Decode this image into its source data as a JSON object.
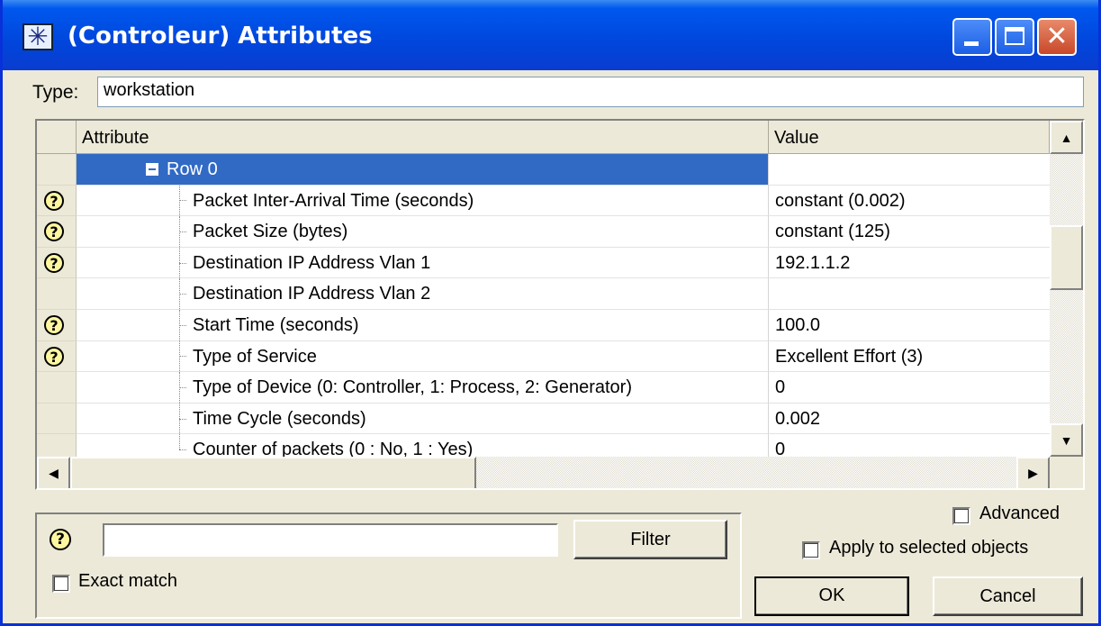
{
  "window": {
    "title": "(Controleur) Attributes",
    "close_glyph": "✕"
  },
  "type_field": {
    "label": "Type:",
    "value": "workstation"
  },
  "grid": {
    "columns": {
      "attribute": "Attribute",
      "value": "Value"
    },
    "group_row": "Row 0",
    "rows": [
      {
        "attribute": "Packet Inter-Arrival Time (seconds)",
        "value": "constant (0.002)",
        "help": true
      },
      {
        "attribute": "Packet Size (bytes)",
        "value": "constant (125)",
        "help": true
      },
      {
        "attribute": "Destination IP Address Vlan 1",
        "value": "192.1.1.2",
        "help": true
      },
      {
        "attribute": "Destination IP Address Vlan 2",
        "value": "",
        "help": false
      },
      {
        "attribute": "Start Time (seconds)",
        "value": "100.0",
        "help": true
      },
      {
        "attribute": "Type of Service",
        "value": "Excellent Effort (3)",
        "help": true
      },
      {
        "attribute": "Type of Device (0: Controller, 1: Process, 2: Generator)",
        "value": "0",
        "help": false
      },
      {
        "attribute": "Time Cycle (seconds)",
        "value": "0.002",
        "help": false
      },
      {
        "attribute": "Counter of packets (0 : No, 1 : Yes)",
        "value": "0",
        "help": false
      }
    ],
    "help_glyph": "?"
  },
  "filter": {
    "input_value": "",
    "button_label": "Filter",
    "exact_match_label": "Exact match",
    "exact_match_checked": false
  },
  "options": {
    "advanced_label": "Advanced",
    "advanced_checked": false,
    "apply_selected_label": "Apply to selected objects",
    "apply_selected_checked": false
  },
  "buttons": {
    "ok": "OK",
    "cancel": "Cancel"
  },
  "colors": {
    "titlebar": "#0046dc",
    "selection": "#316ac5",
    "dialog_bg": "#ece9d8"
  }
}
